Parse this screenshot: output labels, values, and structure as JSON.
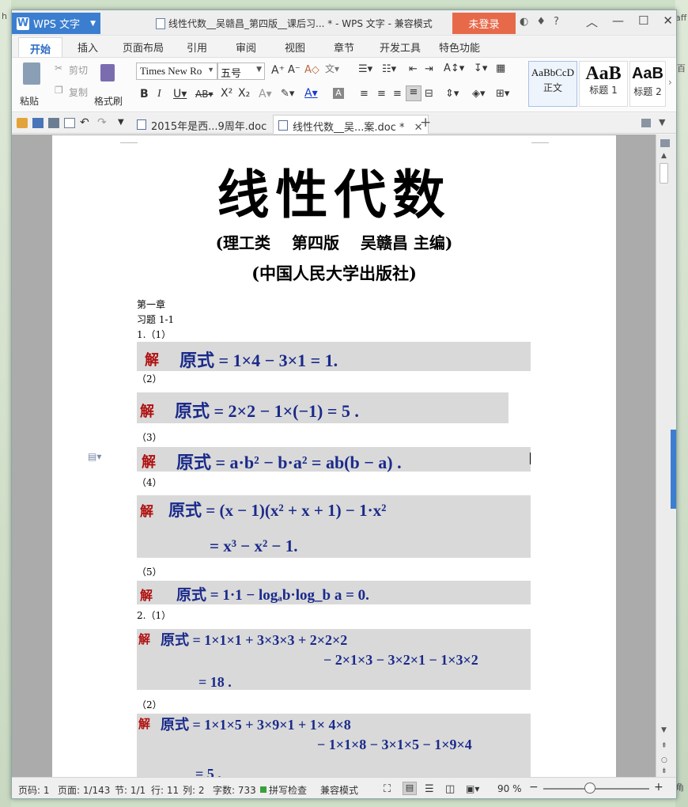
{
  "desktop": {
    "left_fragment": "h",
    "right_fragment_1": "aff",
    "right_fragment_2": "百",
    "right_fragment_3": "角"
  },
  "titlebar": {
    "app_label": "WPS 文字",
    "window_title": "线性代数__吴赣昌_第四版__课后习... * - WPS 文字 - 兼容模式",
    "login_label": "未登录",
    "help_label": "?"
  },
  "menu": {
    "tabs": [
      "开始",
      "插入",
      "页面布局",
      "引用",
      "审阅",
      "视图",
      "章节",
      "开发工具",
      "特色功能"
    ]
  },
  "ribbon": {
    "paste_label": "粘贴",
    "cut_label": "剪切",
    "copy_label": "复制",
    "format_painter_label": "格式刷",
    "font_name": "Times New Ro",
    "font_size": "五号",
    "styles": [
      {
        "sample": "AaBbCcD",
        "label": "正文"
      },
      {
        "sample": "AaB",
        "label": "标题 1"
      },
      {
        "sample": "AaB",
        "label": "标题 2"
      }
    ]
  },
  "doc_tabs": [
    {
      "label": "2015年是西...9周年.doc",
      "closable": false
    },
    {
      "label": "线性代数__吴...案.doc *",
      "closable": true
    }
  ],
  "document": {
    "title": "线性代数",
    "subtitle": "(理工类　 第四版　 吴赣昌 主编)",
    "publisher": "(中国人民大学出版社)",
    "chapter": "第一章",
    "exercise": "习题 1-1",
    "items": [
      {
        "label": "1.（1）",
        "jie": "解",
        "lines": [
          "原式 = 1×4 − 3×1 = 1."
        ]
      },
      {
        "label": "（2）",
        "jie": "解",
        "lines": [
          "原式 = 2×2 − 1×(−1) = 5 ."
        ]
      },
      {
        "label": "（3）",
        "jie": "解",
        "lines": [
          "原式 = a·b² − b·a² = ab(b − a) ."
        ]
      },
      {
        "label": "（4）",
        "jie": "解",
        "lines": [
          "原式 = (x − 1)(x² + x + 1) − 1·x²",
          "= x³ − x² − 1."
        ]
      },
      {
        "label": "（5）",
        "jie": "解",
        "lines": [
          "原式 = 1·1 − logₐb·log_b a = 0."
        ]
      },
      {
        "label": "2.（1）",
        "jie": "解",
        "lines": [
          "原式 = 1×1×1 + 3×3×3 + 2×2×2",
          "− 2×1×3 − 3×2×1 − 1×3×2",
          "= 18 ."
        ]
      },
      {
        "label": "（2）",
        "jie": "解",
        "lines": [
          "原式 = 1×1×5 + 3×9×1 + 1× 4×8",
          "− 1×1×8 − 3×1×5 − 1×9×4",
          "= 5 ."
        ]
      }
    ]
  },
  "statusbar": {
    "page_code": "页码: 1",
    "pages": "页面: 1/143",
    "section": "节: 1/1",
    "row": "行: 11",
    "col": "列: 2",
    "word_count": "字数: 733",
    "spell_check": "拼写检查",
    "compat_mode": "兼容模式",
    "zoom": "90 %",
    "zoom_value_percent": 90
  }
}
